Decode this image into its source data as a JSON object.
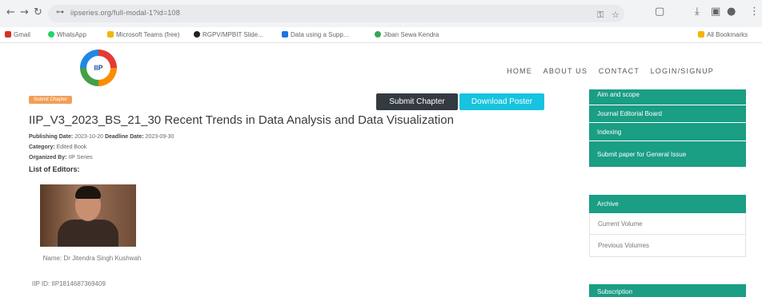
{
  "browser": {
    "url": "iipseries.org/full-modal-1?id=108",
    "bookmarks": [
      "Gmail",
      "WhatsApp",
      "Microsoft Teams (free)",
      "RGPV/MPBIT Slide...",
      "Data using a Supp...",
      "Jiban Sewa Kendra"
    ],
    "all_bookmarks": "All Bookmarks"
  },
  "site": {
    "logo_text": "IIP",
    "nav": [
      "HOME",
      "ABOUT US",
      "CONTACT",
      "LOGIN/SIGNUP"
    ]
  },
  "chapter": {
    "badge": "Submit Chapter",
    "submit_label": "Submit Chapter",
    "download_label": "Download Poster",
    "title": "IIP_V3_2023_BS_21_30 Recent Trends in Data Analysis and Data Visualization",
    "publishing_label": "Publishing Date:",
    "publishing_value": "2023-10-20",
    "deadline_label": "Deadline Date:",
    "deadline_value": "2023-09-30",
    "category_label": "Category:",
    "category_value": "Edited Book",
    "organized_label": "Organized By:",
    "organized_value": "IIP Series",
    "editors_heading": "List of Editors:",
    "editor_name": "Name: Dr Jitendra Singh Kushwah",
    "editor_id": "IIP ID: IIP1814687369409"
  },
  "sidebar": {
    "top_items": [
      "Aim and scope",
      "Journal Editorial Board",
      "Indexing",
      "Submit paper for General Issue"
    ],
    "archive_heading": "Archive",
    "archive_links": [
      "Current Volume",
      "Previous Volumes"
    ],
    "subscription_heading": "Subscription"
  },
  "colors": {
    "accent": "#1a9e84",
    "download_button": "#17c3de",
    "submit_button": "#333a40",
    "badge": "#f0a056"
  },
  "icons": [
    "back-arrow-icon",
    "forward-arrow-icon",
    "reload-icon",
    "site-info-icon",
    "key-icon",
    "star-icon",
    "extensions-icon",
    "download-icon",
    "sidebar-icon",
    "profile-icon",
    "menu-icon",
    "folder-icon"
  ]
}
